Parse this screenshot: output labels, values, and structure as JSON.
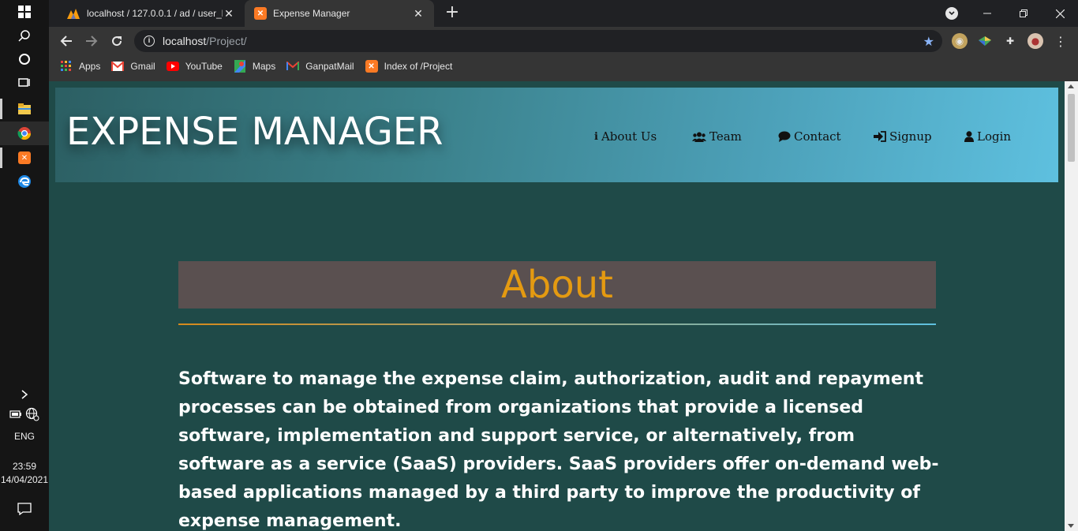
{
  "taskbar": {
    "language": "ENG",
    "time": "23:59",
    "date": "14/04/2021"
  },
  "tabs": [
    {
      "title": "localhost / 127.0.0.1 / ad / user_l",
      "active": false,
      "favicon": "phpmyadmin-icon"
    },
    {
      "title": "Expense Manager",
      "active": true,
      "favicon": "xampp-icon"
    }
  ],
  "address_bar": {
    "host": "localhost",
    "path": "/Project/"
  },
  "bookmarks": [
    {
      "label": "Apps",
      "icon": "apps-grid-icon"
    },
    {
      "label": "Gmail",
      "icon": "gmail-icon"
    },
    {
      "label": "YouTube",
      "icon": "youtube-icon"
    },
    {
      "label": "Maps",
      "icon": "maps-icon"
    },
    {
      "label": "GanpatMail",
      "icon": "gmail-icon"
    },
    {
      "label": "Index of /Project",
      "icon": "xampp-icon"
    }
  ],
  "site": {
    "brand": "EXPENSE MANAGER",
    "nav": [
      {
        "label": "About Us",
        "icon": "info-icon"
      },
      {
        "label": "Team",
        "icon": "users-icon"
      },
      {
        "label": "Contact",
        "icon": "comment-icon"
      },
      {
        "label": "Signup",
        "icon": "sign-in-icon"
      },
      {
        "label": "Login",
        "icon": "user-icon"
      }
    ],
    "about_title": "About",
    "about_text": "Software to manage the expense claim, authorization, audit and repayment processes can be obtained from organizations that provide a licensed software, implementation and support service, or alternatively, from software as a service (SaaS) providers. SaaS providers offer on-demand web-based applications managed by a third party to improve the productivity of expense management."
  },
  "colors": {
    "page_bg": "#1f4a48",
    "about_title": "#e49a11",
    "about_box": "#5a5050"
  }
}
